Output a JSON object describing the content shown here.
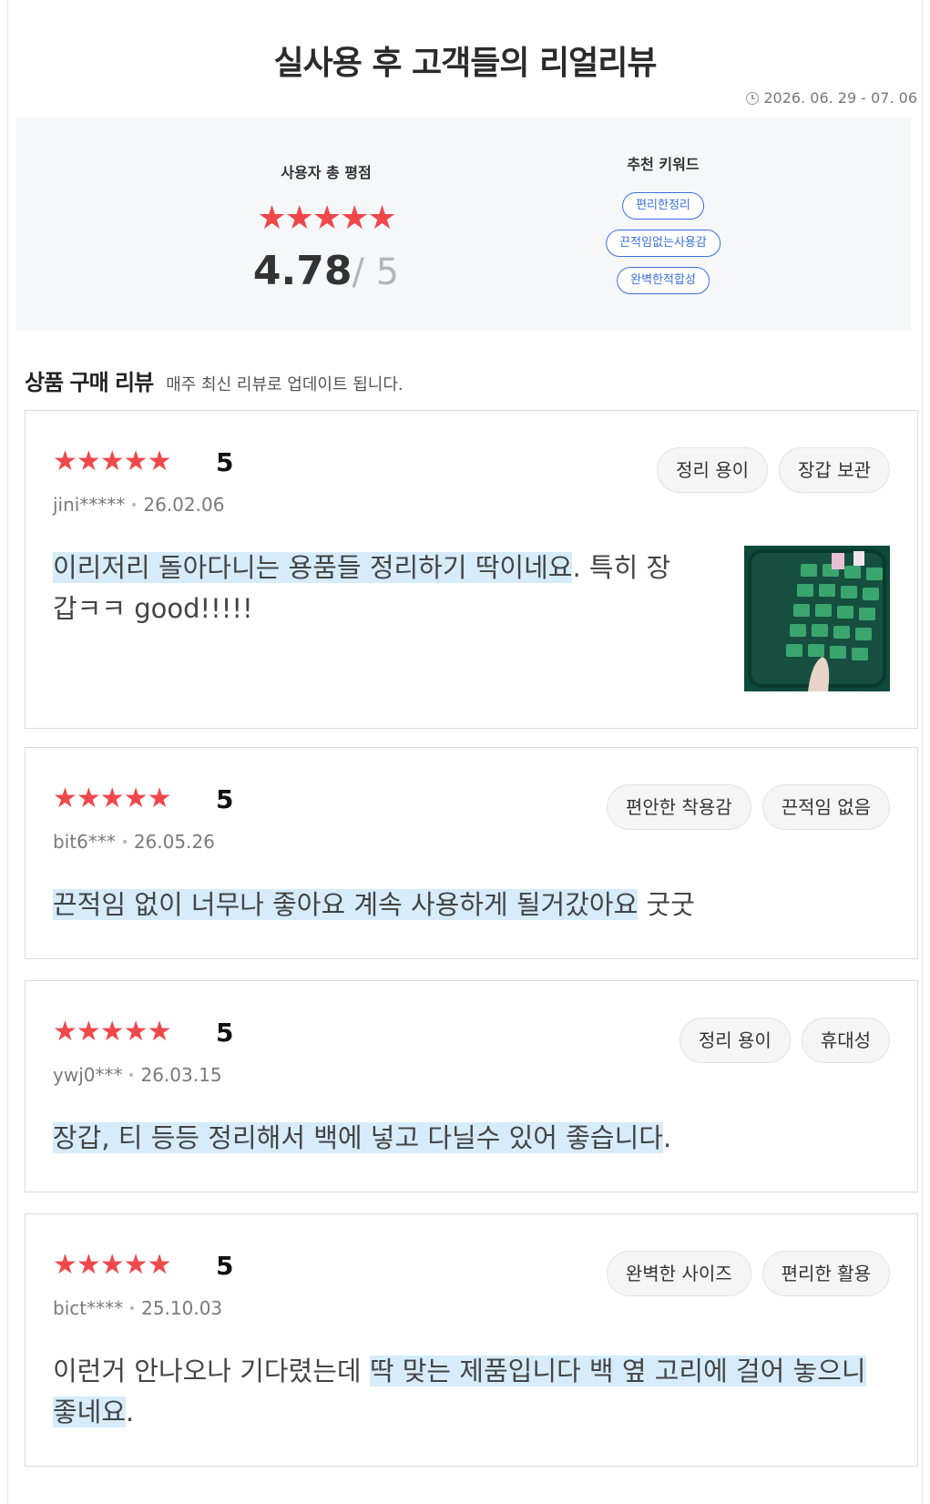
{
  "title": "실사용 후 고객들의 리얼리뷰",
  "period": "2026. 06. 29 - 07. 06",
  "summary": {
    "rating_label": "사용자 총 평점",
    "stars": "★★★★★",
    "rating_value": "4.78",
    "rating_max": "/ 5",
    "keywords_label": "추천 키워드",
    "keywords": [
      "편리한정리",
      "끈적임없는사용감",
      "완벽한적합성"
    ]
  },
  "section": {
    "title": "상품 구매 리뷰",
    "subtitle": "매주 최신 리뷰로 업데이트 됩니다."
  },
  "reviews": [
    {
      "stars": "★★★★★",
      "score": "5",
      "user": "jini*****",
      "date": "26.02.06",
      "tags": [
        "정리 용이",
        "장갑 보관"
      ],
      "text_highlight": "이리저리 돌아다니는 용품들 정리하기 딱이네요",
      "text_line1_rest": ". 특히 장",
      "text_line2": "갑ㅋㅋ good!!!!!",
      "has_photo": true
    },
    {
      "stars": "★★★★★",
      "score": "5",
      "user": "bit6***",
      "date": "26.05.26",
      "tags": [
        "편안한 착용감",
        "끈적임 없음"
      ],
      "text_highlight": "끈적임 없이 너무나 좋아요 계속 사용하게 될거갔아요",
      "text_rest": " 굿굿"
    },
    {
      "stars": "★★★★★",
      "score": "5",
      "user": "ywj0***",
      "date": "26.03.15",
      "tags": [
        "정리 용이",
        "휴대성"
      ],
      "text_highlight": "장갑, 티 등등 정리해서 백에 넣고 다닐수 있어 좋습니다",
      "text_rest": "."
    },
    {
      "stars": "★★★★★",
      "score": "5",
      "user": "bict****",
      "date": "25.10.03",
      "tags": [
        "완벽한 사이즈",
        "편리한 활용"
      ],
      "text_plain": "이런거 안나오나 기다렸는데 ",
      "text_highlight1": "딱 맞는 제품입니다 백 옆 고리에 걸어 놓으니",
      "text_highlight2": "좋네요",
      "text_rest": "."
    }
  ],
  "colors": {
    "star": "#f0474b",
    "keyword": "#3a6fe0",
    "highlight": "#d6ecfb",
    "summary_bg": "#f6f7f9"
  }
}
